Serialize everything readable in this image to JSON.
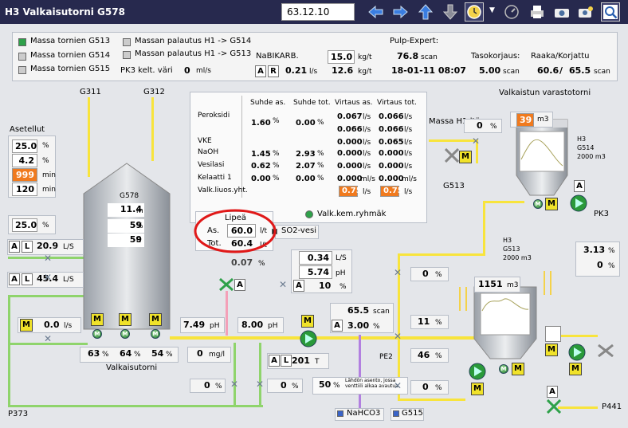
{
  "header": {
    "title": "H3 Valkaisutorni G578",
    "date": "63.12.10"
  },
  "toolbar": [
    "back-arrow-icon",
    "forward-arrow-icon",
    "up-arrow-icon",
    "down-arrow-icon",
    "clock-history-icon",
    "dropdown-icon",
    "gauge-icon",
    "print-icon",
    "camera-icon",
    "camera-settings-icon",
    "zoom-icon"
  ],
  "top": {
    "massa": [
      {
        "label": "Massa tornien G513",
        "on": true
      },
      {
        "label": "Massa tornien G514",
        "on": false
      },
      {
        "label": "Massa tornien G515",
        "on": false
      }
    ],
    "palautus": [
      {
        "label": "Massan palautus H1 -> G514"
      },
      {
        "label": "Massan palautus H1 -> G513"
      }
    ],
    "pk3_label": "PK3 kelt. väri",
    "pk3_val": "0",
    "pk3_unit": "ml/s",
    "nabi_label": "NaBIKARB.",
    "nabi_val1": "15.0",
    "nabi_u1": "kg/t",
    "nabi_a": "A",
    "nabi_r": "R",
    "nabi_val2": "0.21",
    "nabi_u2": "l/s",
    "nabi_val3": "12.6",
    "nabi_u3": "kg/t",
    "pulp_label": "Pulp-Expert:",
    "pulp_val": "76.8",
    "pulp_unit": "scan",
    "pulp_date": "18-01-11 08:07",
    "taso_label": "Tasokorjaus:",
    "taso_val": "5.00",
    "taso_unit": "scan",
    "raaka_label": "Raaka/Korjattu",
    "raaka_val": "60.6",
    "raaka_sep": "/",
    "korj_val": "65.5",
    "raaka_unit": "scan"
  },
  "chem": {
    "headers": [
      "Suhde as.",
      "Suhde tot.",
      "Virtaus as.",
      "Virtaus tot."
    ],
    "rows": [
      {
        "name": "Peroksidi",
        "s1": "1.60",
        "s1u": "%",
        "s2": "0.00",
        "s2u": "%",
        "v1a": "0.067",
        "v1au": "l/s",
        "v1b": "0.066",
        "v1bu": "l/s",
        "v2a": "0.066",
        "v2au": "l/s",
        "v2b": "0.066",
        "v2bu": "l/s"
      },
      {
        "name": "VKE",
        "v1": "0.000",
        "v1u": "l/s",
        "v2": "0.065",
        "v2u": "l/s"
      },
      {
        "name": "NaOH",
        "s1": "1.45",
        "s1u": "%",
        "s2": "2.93",
        "s2u": "%",
        "v1": "0.000",
        "v1u": "l/s",
        "v2": "0.000",
        "v2u": "l/s"
      },
      {
        "name": "Vesilasi",
        "s1": "0.62",
        "s1u": "%",
        "s2": "2.07",
        "s2u": "%",
        "v1": "0.000",
        "v1u": "l/s",
        "v2": "0.000",
        "v2u": "l/s"
      },
      {
        "name": "Kelaatti 1",
        "s1": "0.00",
        "s1u": "%",
        "s2": "0.00",
        "s2u": "%",
        "v1": "0.000",
        "v1u": "ml/s",
        "v2": "0.000",
        "v2u": "ml/s"
      },
      {
        "name": "Valk.liuos.yht.",
        "v1": "0.75",
        "v1u": "l/s",
        "v2": "0.75",
        "v2u": "l/s"
      }
    ],
    "ryhma": "Valk.kem.ryhmäk"
  },
  "lipea": {
    "title": "Lipeä",
    "as_label": "As.",
    "as_val": "60.0",
    "as_unit": "l/t",
    "tot_label": "Tot.",
    "tot_val": "60.4",
    "tot_unit": "l/t",
    "so2": "SO2-vesi"
  },
  "asetellut": {
    "title": "Asetellut",
    "v1": "25.0",
    "u1": "%",
    "v2": "4.2",
    "u2": "%",
    "v3": "999",
    "u3": "min",
    "v4": "120",
    "u4": "min"
  },
  "left": {
    "g311": "G311",
    "g312": "G312",
    "r25": "25.0",
    "r25u": "%",
    "a": "A",
    "l": "L",
    "f1": "20.9",
    "f1u": "L/S",
    "f2": "45.4",
    "f2u": "L/S",
    "m": "M",
    "f3": "0.0",
    "f3u": "l/s",
    "p373": "P373"
  },
  "tower": {
    "name": "G578",
    "lvl": "11.4",
    "lvl_u": "m",
    "cons": "59",
    "cons_u": "%",
    "temp": "59",
    "temp_u": "C",
    "caption": "Valkaisutorni",
    "o1": "63",
    "o2": "64",
    "o3": "54",
    "ou": "%"
  },
  "mid": {
    "ph1": "7.49",
    "ph1u": "pH",
    "ph2": "8.00",
    "ph2u": "pH",
    "mgl": "0",
    "mglu": "mg/l",
    "l201": "201",
    "l201u": "T",
    "v1": "0",
    "v1u": "%",
    "v2": "0",
    "v2u": "%",
    "lahdon": "50",
    "lahdon_u": "%",
    "lahdon_text": "Lähdön asento, jossa venttiili alkaa avautua",
    "nahco3": "NaHCO3",
    "g515": "G515",
    "pe2": "PE2",
    "s034": "0.34",
    "s034u": "L/S",
    "s574": "5.74",
    "s574u": "pH",
    "s10": "10",
    "s10u": "%",
    "scan655": "65.5",
    "scanu": "scan",
    "s300": "3.00",
    "s300u": "%",
    "x007": "0.07",
    "x007u": "%"
  },
  "right": {
    "massa_h1": "Massa H1:ltä",
    "v_h1": "0",
    "v_h1u": "%",
    "tower_title": "Valkaistun varastotorni",
    "g514_lvl": "39",
    "g514_u": "m3",
    "g514_name": "H3",
    "g514_sub": "G514",
    "g514_vol": "2000 m3",
    "g513_out": "G513",
    "pk3": "PK3",
    "g513_name": "H3",
    "g513_sub": "G513",
    "g513_vol": "2000 m3",
    "g513_lvl": "1151",
    "g513_u": "m3",
    "c1": "3.13",
    "c2": "0",
    "cu": "%",
    "v0a": "0",
    "v11": "11",
    "v46": "46",
    "v0b": "0",
    "vu": "%",
    "p441": "P441"
  }
}
